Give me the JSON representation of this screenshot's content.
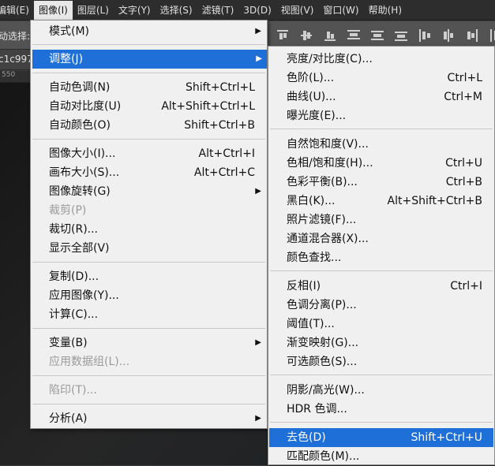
{
  "menubar": {
    "items": [
      "编辑(E)",
      "图像(I)",
      "图层(L)",
      "文字(Y)",
      "选择(S)",
      "滤镜(T)",
      "3D(D)",
      "视图(V)",
      "窗口(W)",
      "帮助(H)"
    ]
  },
  "options": {
    "select_label": "动选择:"
  },
  "tab": {
    "text": "c1c997"
  },
  "ruler": {
    "text": "550"
  },
  "image_menu": {
    "mode": "模式(M)",
    "adjust": "调整(J)",
    "auto_tone": "自动色调(N)",
    "auto_tone_sc": "Shift+Ctrl+L",
    "auto_contrast": "自动对比度(U)",
    "auto_contrast_sc": "Alt+Shift+Ctrl+L",
    "auto_color": "自动颜色(O)",
    "auto_color_sc": "Shift+Ctrl+B",
    "image_size": "图像大小(I)...",
    "image_size_sc": "Alt+Ctrl+I",
    "canvas_size": "画布大小(S)...",
    "canvas_size_sc": "Alt+Ctrl+C",
    "rotation": "图像旋转(G)",
    "crop": "裁剪(P)",
    "trim": "裁切(R)...",
    "reveal_all": "显示全部(V)",
    "duplicate": "复制(D)...",
    "apply_image": "应用图像(Y)...",
    "calculations": "计算(C)...",
    "variables": "变量(B)",
    "apply_data_set": "应用数据组(L)...",
    "trap": "陷印(T)...",
    "analysis": "分析(A)"
  },
  "adjust_menu": {
    "brightness": "亮度/对比度(C)...",
    "levels": "色阶(L)...",
    "levels_sc": "Ctrl+L",
    "curves": "曲线(U)...",
    "curves_sc": "Ctrl+M",
    "exposure": "曝光度(E)...",
    "vibrance": "自然饱和度(V)...",
    "hue_sat": "色相/饱和度(H)...",
    "hue_sat_sc": "Ctrl+U",
    "color_balance": "色彩平衡(B)...",
    "color_balance_sc": "Ctrl+B",
    "bw": "黑白(K)...",
    "bw_sc": "Alt+Shift+Ctrl+B",
    "photo_filter": "照片滤镜(F)...",
    "channel_mixer": "通道混合器(X)...",
    "color_lookup": "颜色查找...",
    "invert": "反相(I)",
    "invert_sc": "Ctrl+I",
    "posterize": "色调分离(P)...",
    "threshold": "阈值(T)...",
    "gradient_map": "渐变映射(G)...",
    "selective_color": "可选颜色(S)...",
    "shadows": "阴影/高光(W)...",
    "hdr": "HDR 色调...",
    "desaturate": "去色(D)",
    "desaturate_sc": "Shift+Ctrl+U",
    "match_color": "匹配颜色(M)..."
  },
  "colors": {
    "highlight": "#1f6fd8",
    "menu_bg": "#f0f0f0"
  }
}
